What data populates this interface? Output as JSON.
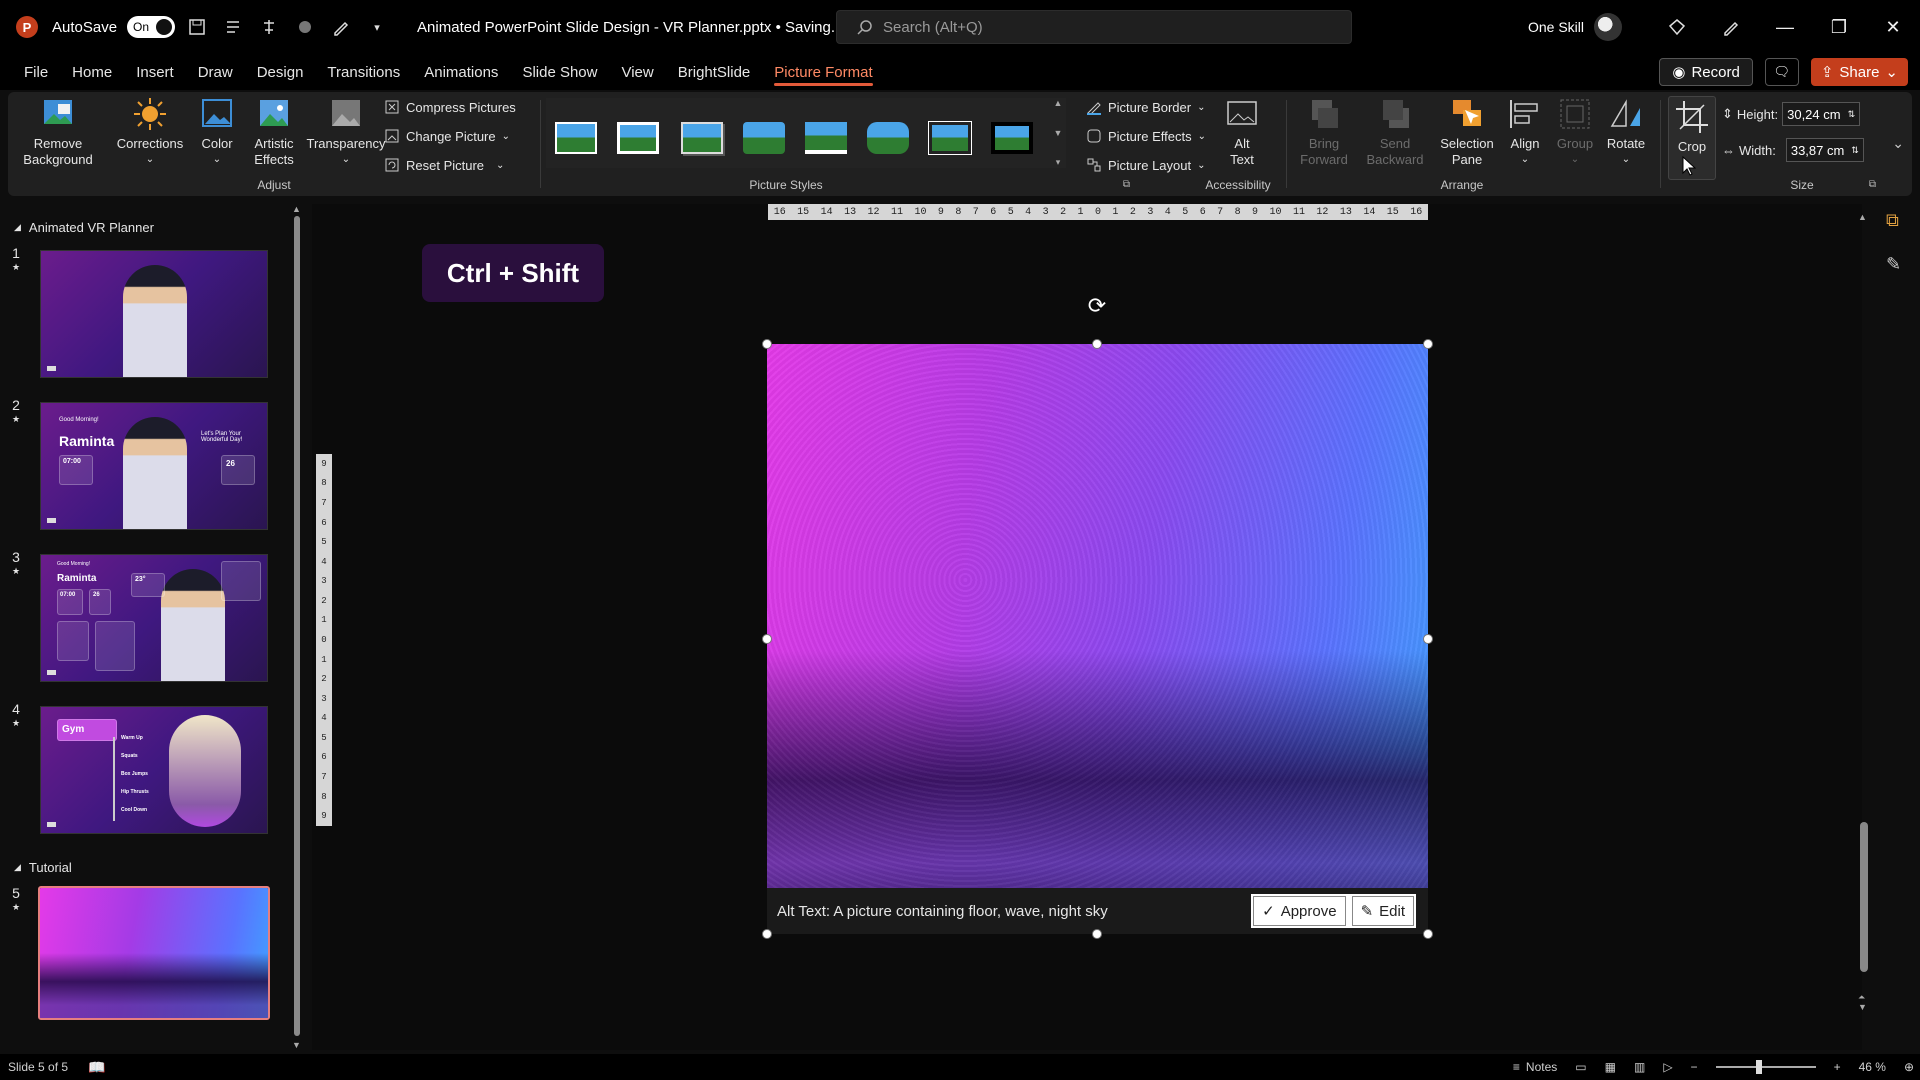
{
  "titlebar": {
    "app_logo": "P",
    "autosave_label": "AutoSave",
    "autosave_state": "On",
    "doc_title": "Animated PowerPoint Slide Design - VR Planner.pptx • Saving...",
    "search_placeholder": "Search (Alt+Q)",
    "user_name": "One Skill"
  },
  "menu": {
    "tabs": [
      "File",
      "Home",
      "Insert",
      "Draw",
      "Design",
      "Transitions",
      "Animations",
      "Slide Show",
      "View",
      "BrightSlide",
      "Picture Format"
    ],
    "active_tab": "Picture Format",
    "record_label": "Record",
    "share_label": "Share"
  },
  "ribbon": {
    "adjust": {
      "label": "Adjust",
      "remove_background": [
        "Remove",
        "Background"
      ],
      "corrections": "Corrections",
      "color": "Color",
      "artistic_effects": [
        "Artistic",
        "Effects"
      ],
      "transparency": "Transparency",
      "compress": "Compress Pictures",
      "change": "Change Picture",
      "reset": "Reset Picture"
    },
    "picture_styles": {
      "label": "Picture Styles",
      "border": "Picture Border",
      "effects": "Picture Effects",
      "layout": "Picture Layout"
    },
    "accessibility": {
      "label": "Accessibility",
      "alt_text": [
        "Alt",
        "Text"
      ]
    },
    "arrange": {
      "label": "Arrange",
      "bring_forward": [
        "Bring",
        "Forward"
      ],
      "send_backward": [
        "Send",
        "Backward"
      ],
      "selection_pane": [
        "Selection",
        "Pane"
      ],
      "align": "Align",
      "group": "Group",
      "rotate": "Rotate"
    },
    "size": {
      "label": "Size",
      "crop": "Crop",
      "height_label": "Height:",
      "height_value": "30,24 cm",
      "width_label": "Width:",
      "width_value": "33,87 cm"
    }
  },
  "thumbnails": {
    "section1": "Animated VR Planner",
    "section2": "Tutorial",
    "slides": [
      {
        "num": "1"
      },
      {
        "num": "2",
        "greeting": "Good Morning!",
        "name": "Raminta",
        "time": "07:00",
        "tagline": "Let's Plan Your Wonderful Day!",
        "date": "26"
      },
      {
        "num": "3",
        "greeting": "Good Morning!",
        "name": "Raminta",
        "time": "07:00",
        "date": "26",
        "temp": "23°"
      },
      {
        "num": "4",
        "title": "Gym",
        "items": [
          "Warm Up",
          "Squats",
          "Box Jumps",
          "Hip Thrusts",
          "Cool Down"
        ]
      },
      {
        "num": "5"
      }
    ]
  },
  "canvas": {
    "shortcut_badge": "Ctrl + Shift",
    "ruler_h": [
      "16",
      "15",
      "14",
      "13",
      "12",
      "11",
      "10",
      "9",
      "8",
      "7",
      "6",
      "5",
      "4",
      "3",
      "2",
      "1",
      "0",
      "1",
      "2",
      "3",
      "4",
      "5",
      "6",
      "7",
      "8",
      "9",
      "10",
      "11",
      "12",
      "13",
      "14",
      "15",
      "16"
    ],
    "ruler_v": [
      "9",
      "8",
      "7",
      "6",
      "5",
      "4",
      "3",
      "2",
      "1",
      "0",
      "1",
      "2",
      "3",
      "4",
      "5",
      "6",
      "7",
      "8",
      "9"
    ],
    "alt_text": "Alt Text: A picture containing floor, wave, night sky",
    "approve_label": "Approve",
    "edit_label": "Edit"
  },
  "statusbar": {
    "slide_info": "Slide 5 of 5",
    "notes_label": "Notes",
    "zoom_level": "46 %"
  },
  "colors": {
    "accent": "#c43e1c",
    "active_tab": "#ff8a65",
    "ribbon_bg": "#202020"
  }
}
